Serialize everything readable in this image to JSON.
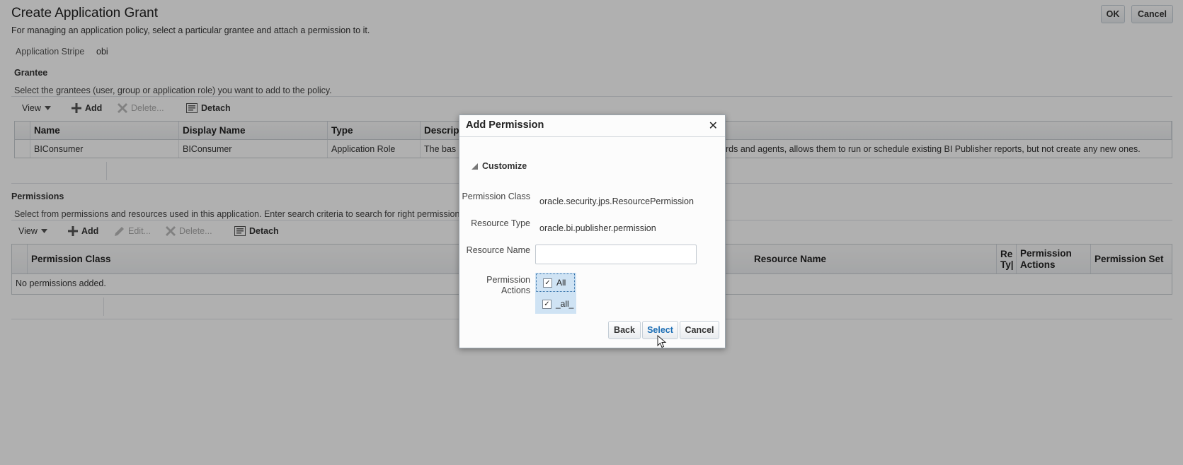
{
  "page": {
    "title": "Create Application Grant",
    "description": "For managing an application policy, select a particular grantee and attach a permission to it.",
    "ok_label": "OK",
    "cancel_label": "Cancel",
    "stripe_label": "Application Stripe",
    "stripe_value": "obi"
  },
  "grantee": {
    "title": "Grantee",
    "hint": "Select the grantees (user, group or application role) you want to add to the policy.",
    "toolbar": {
      "view": "View",
      "add": "Add",
      "delete": "Delete...",
      "detach": "Detach"
    },
    "columns": [
      "Name",
      "Display Name",
      "Type",
      "Descrip"
    ],
    "rows": [
      {
        "name": "BIConsumer",
        "display_name": "BIConsumer",
        "type": "Application Role",
        "desc_start": "The bas",
        "desc_end": "rds and agents, allows them to run or schedule existing BI Publisher reports, but not create any new ones."
      }
    ]
  },
  "permissions": {
    "title": "Permissions",
    "hint": "Select from permissions and resources used in this application. Enter search criteria to search for right permission",
    "toolbar": {
      "view": "View",
      "add": "Add",
      "edit": "Edit...",
      "delete": "Delete...",
      "detach": "Detach"
    },
    "columns": {
      "permission_class": "Permission Class",
      "resource_name": "Resource Name",
      "resource_type_short1": "Re",
      "resource_type_short2": "Ty|",
      "permission_actions": "Permission Actions",
      "permission_set": "Permission Set"
    },
    "empty_text": "No permissions added."
  },
  "dialog": {
    "title": "Add Permission",
    "section": "Customize",
    "fields": {
      "permission_class_label": "Permission Class",
      "permission_class_value": "oracle.security.jps.ResourcePermission",
      "resource_type_label": "Resource Type",
      "resource_type_value": "oracle.bi.publisher.permission",
      "resource_name_label": "Resource Name",
      "resource_name_value": "",
      "permission_actions_label": "Permission Actions"
    },
    "actions": [
      {
        "label": "All",
        "checked": true
      },
      {
        "label": "_all_",
        "checked": true
      }
    ],
    "buttons": {
      "back": "Back",
      "select": "Select",
      "cancel": "Cancel"
    }
  },
  "icons": {
    "close": "close-icon",
    "add": "plus-icon",
    "delete": "x-icon",
    "detach": "detach-icon",
    "edit": "pencil-icon",
    "dropdown": "triangle-down-icon",
    "collapse": "triangle-collapse-icon",
    "cursor": "mouse-pointer-icon"
  },
  "colors": {
    "accent": "#1e6fb5",
    "selection": "#cfe3f4"
  }
}
